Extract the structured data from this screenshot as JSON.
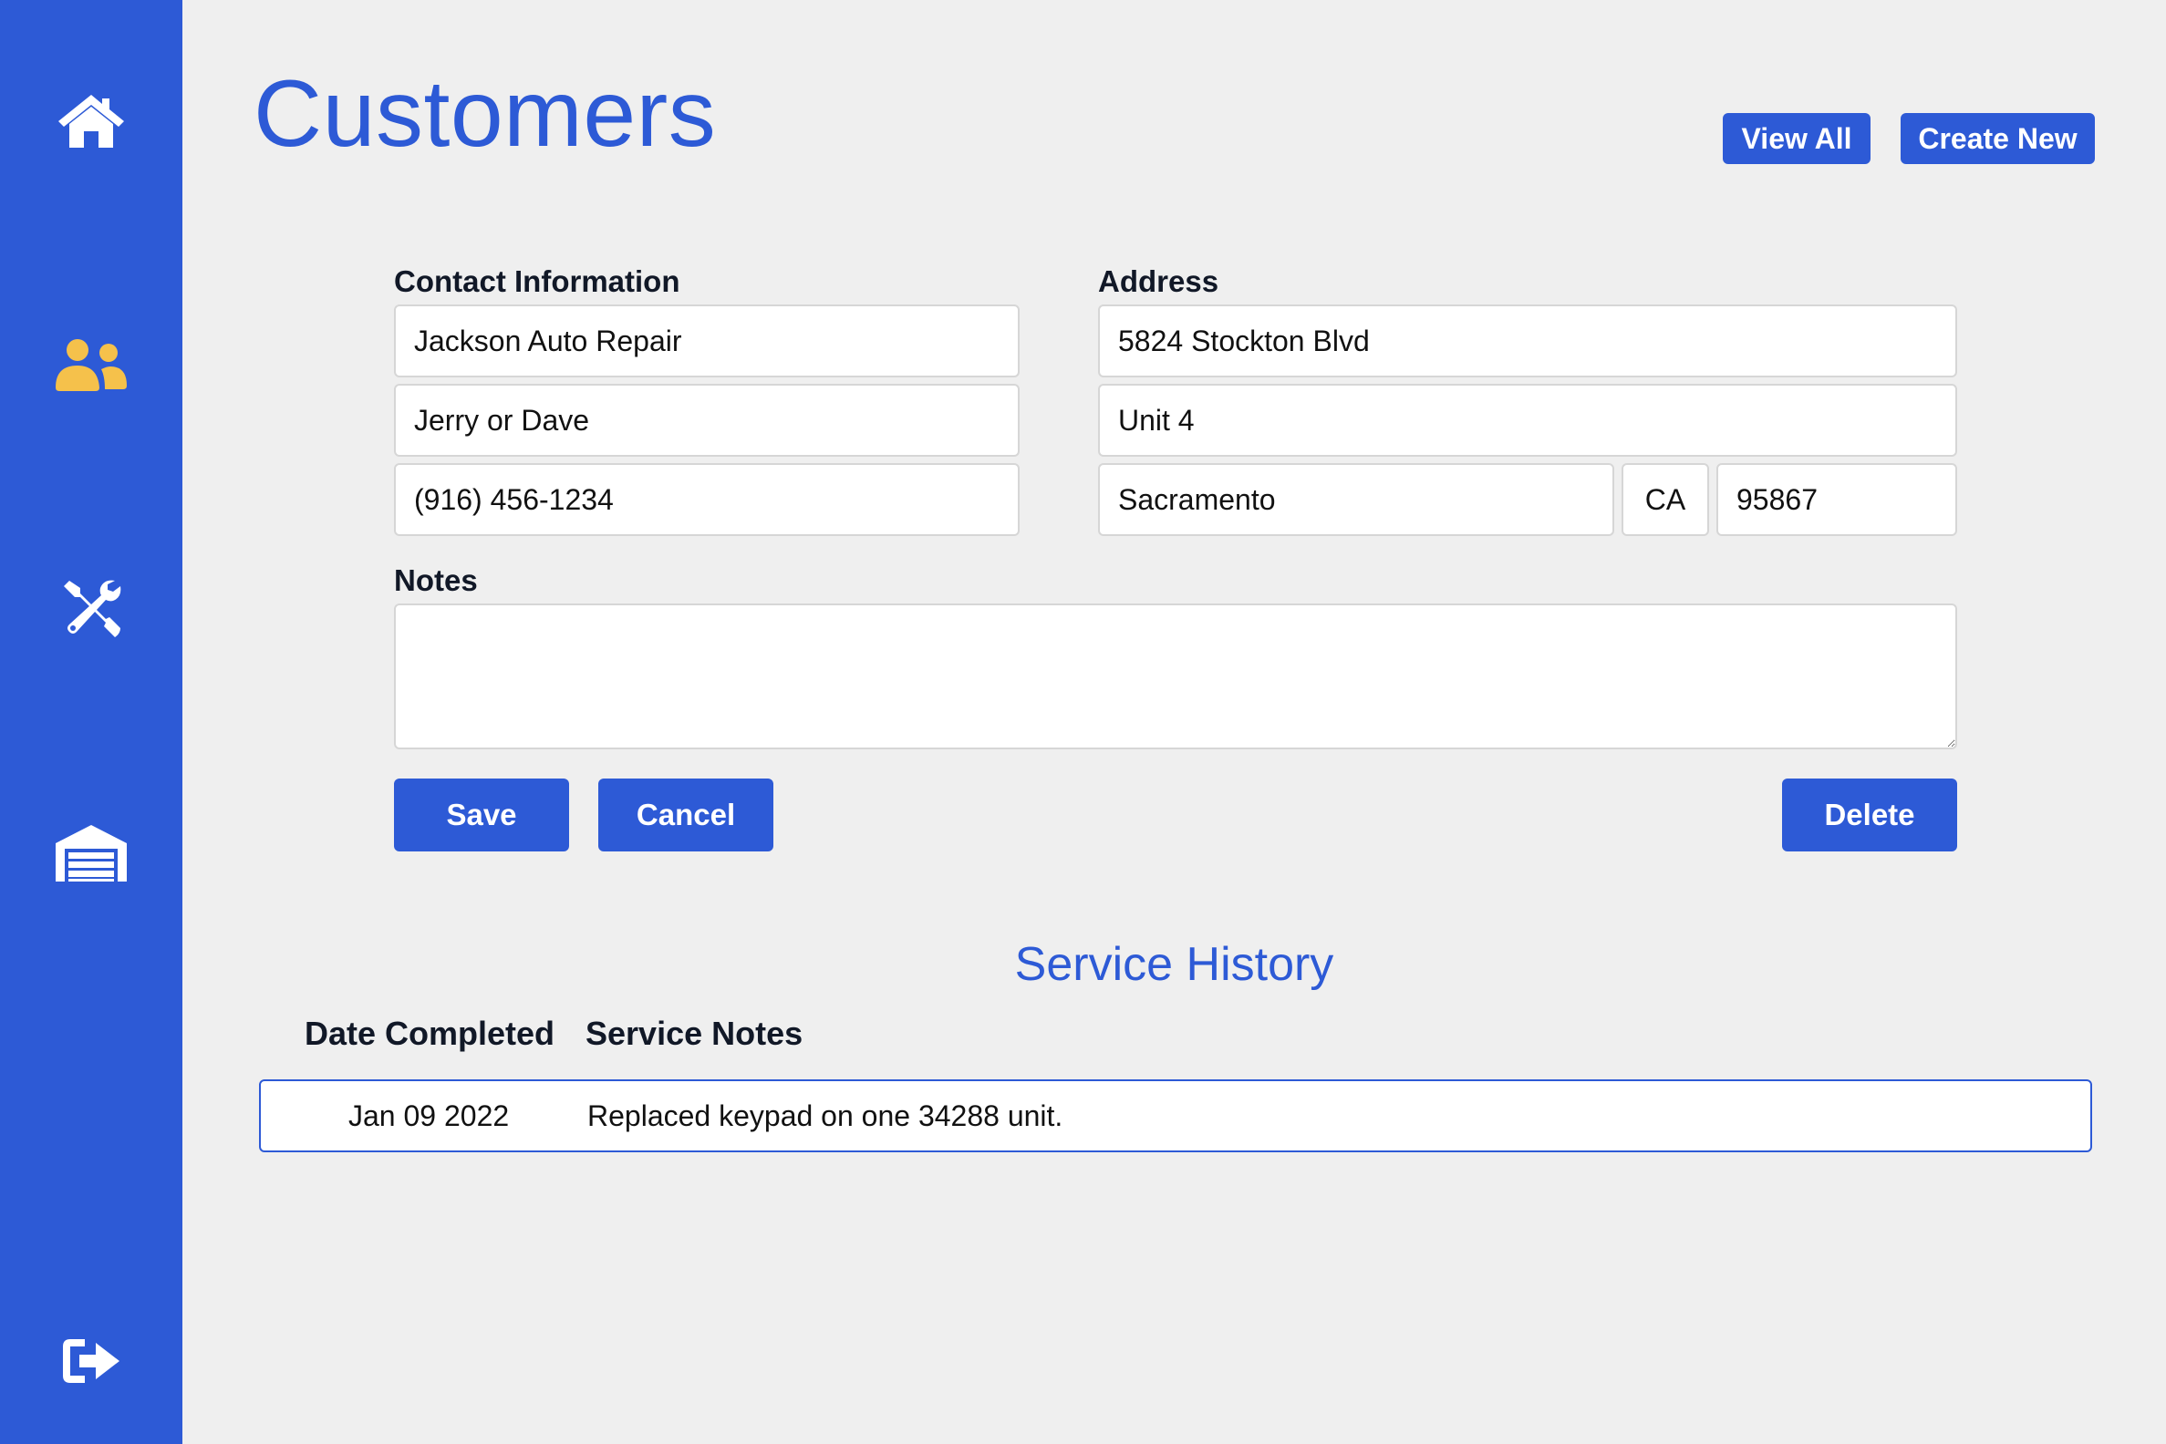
{
  "page": {
    "title": "Customers",
    "view_all_label": "View All",
    "create_new_label": "Create New"
  },
  "sidebar": {
    "items": [
      {
        "icon": "home-icon",
        "color": "#ffffff"
      },
      {
        "icon": "users-icon",
        "color": "#f5c14b",
        "active": true
      },
      {
        "icon": "tools-icon",
        "color": "#ffffff"
      },
      {
        "icon": "garage-icon",
        "color": "#ffffff"
      },
      {
        "icon": "sign-out-icon",
        "color": "#ffffff"
      }
    ]
  },
  "form": {
    "contact_label": "Contact Information",
    "address_label": "Address",
    "notes_label": "Notes",
    "company": "Jackson Auto Repair",
    "contact_name": "Jerry or Dave",
    "phone": "(916) 456-1234",
    "street": "5824 Stockton Blvd",
    "unit": "Unit 4",
    "city": "Sacramento",
    "state": "CA",
    "zip": "95867",
    "notes": "",
    "save_label": "Save",
    "cancel_label": "Cancel",
    "delete_label": "Delete"
  },
  "history": {
    "title": "Service History",
    "columns": [
      "Date Completed",
      "Service Notes"
    ],
    "rows": [
      {
        "date": "Jan 09 2022",
        "notes": "Replaced keypad on one 34288 unit."
      }
    ]
  },
  "colors": {
    "accent": "#2d5ad6",
    "active_icon": "#f5c14b",
    "background": "#efefef"
  }
}
